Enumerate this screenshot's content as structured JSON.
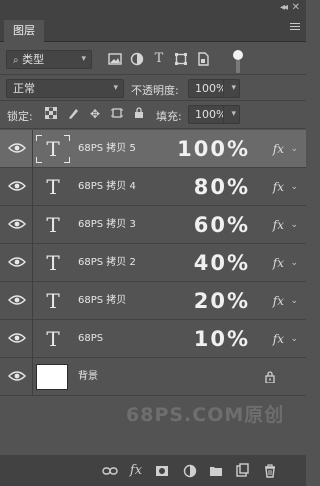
{
  "window": {
    "collapse_icon": "double-chevron-icon",
    "close_icon": "close-icon"
  },
  "panel": {
    "tab_label": "图层",
    "menu_icon": "hamburger-menu-icon"
  },
  "filter": {
    "kind_label": "类型",
    "icons": [
      "image-filter-icon",
      "adjustment-filter-icon",
      "type-filter-icon",
      "shape-filter-icon",
      "smart-object-filter-icon"
    ]
  },
  "blend": {
    "mode": "正常",
    "opacity_label": "不透明度:",
    "opacity_value": "100%"
  },
  "lock": {
    "label": "锁定:",
    "fill_label": "填充:",
    "fill_value": "100%"
  },
  "layers": [
    {
      "name": "68PS 拷贝 5",
      "preview": "100%",
      "fx": "fx",
      "selected": true
    },
    {
      "name": "68PS 拷贝 4",
      "preview": "80%",
      "fx": "fx",
      "selected": false
    },
    {
      "name": "68PS 拷贝 3",
      "preview": "60%",
      "fx": "fx",
      "selected": false
    },
    {
      "name": "68PS 拷贝 2",
      "preview": "40%",
      "fx": "fx",
      "selected": false
    },
    {
      "name": "68PS 拷贝",
      "preview": "20%",
      "fx": "fx",
      "selected": false
    },
    {
      "name": "68PS",
      "preview": "10%",
      "fx": "fx",
      "selected": false
    }
  ],
  "background_layer": {
    "name": "背景",
    "locked": true
  },
  "type_thumb": "T",
  "watermark": "68PS.COM原创",
  "bottom_toolbar": [
    "link-layers-icon",
    "fx-icon",
    "add-mask-icon",
    "adjustment-layer-icon",
    "new-group-icon",
    "new-layer-icon",
    "delete-layer-icon"
  ],
  "colors": {
    "panel_bg": "#535353",
    "bar_bg": "#424242",
    "selected_layer": "#6a6a6a",
    "watermark": "#6e6e6e"
  }
}
